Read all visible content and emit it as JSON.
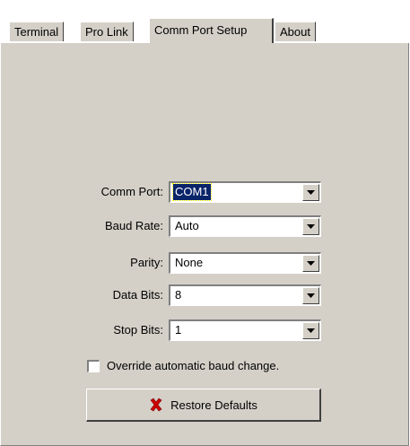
{
  "tabs": [
    {
      "label": "Terminal",
      "active": false
    },
    {
      "label": "Pro Link",
      "active": false
    },
    {
      "label": "Comm Port Setup",
      "active": true
    },
    {
      "label": "About",
      "active": false
    }
  ],
  "form": {
    "comm_port": {
      "label": "Comm Port:",
      "value": "COM1",
      "focused": true
    },
    "baud_rate": {
      "label": "Baud Rate:",
      "value": "Auto"
    },
    "parity": {
      "label": "Parity:",
      "value": "None"
    },
    "data_bits": {
      "label": "Data Bits:",
      "value": "8"
    },
    "stop_bits": {
      "label": "Stop Bits:",
      "value": "1"
    }
  },
  "override_checkbox": {
    "label": "Override automatic baud change.",
    "checked": false
  },
  "restore_button": {
    "label": "Restore Defaults",
    "icon": "red-x-icon"
  },
  "colors": {
    "panel": "#d4d0c8",
    "selection": "#0a246a",
    "icon_red": "#cc0000"
  },
  "icons": {
    "dropdown": "chevron-down-icon"
  }
}
